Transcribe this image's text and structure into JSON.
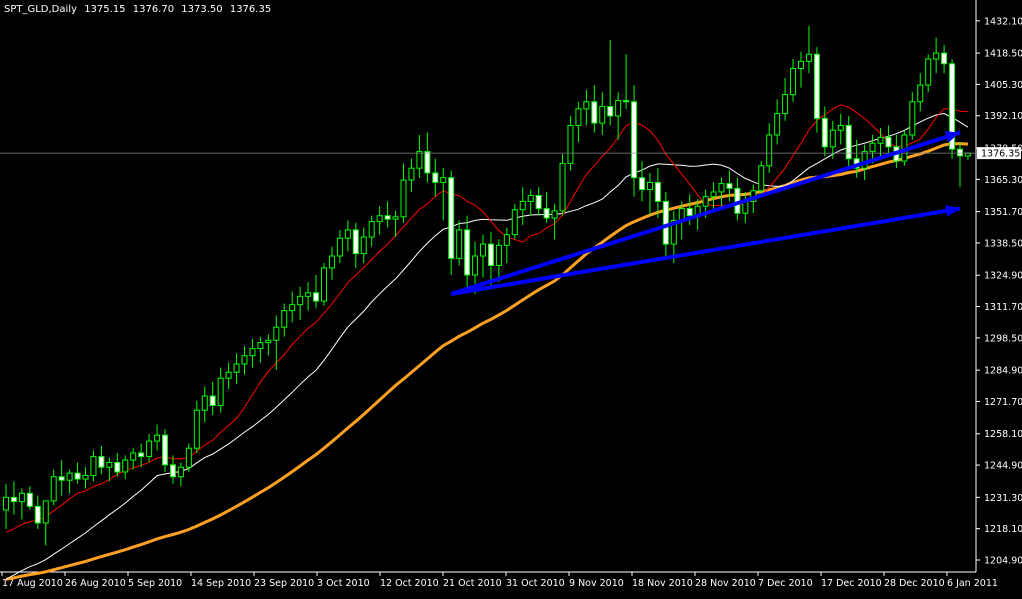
{
  "header": {
    "symbol": "SPT_GLD,Daily",
    "open": "1375.15",
    "high": "1376.70",
    "low": "1373.50",
    "close": "1376.35"
  },
  "chart_data": {
    "type": "candlestick",
    "title": "SPT_GLD,Daily",
    "ylim": [
      1204.9,
      1437.5
    ],
    "y_ticks": [
      "1432.10",
      "1418.50",
      "1405.30",
      "1392.10",
      "1378.50",
      "1365.30",
      "1351.70",
      "1338.50",
      "1324.90",
      "1311.70",
      "1298.50",
      "1284.90",
      "1271.70",
      "1258.10",
      "1244.90",
      "1231.30",
      "1218.10",
      "1204.90"
    ],
    "x_tick_labels": [
      "17 Aug 2010",
      "26 Aug 2010",
      "5 Sep 2010",
      "14 Sep 2010",
      "23 Sep 2010",
      "3 Oct 2010",
      "12 Oct 2010",
      "21 Oct 2010",
      "31 Oct 2010",
      "9 Nov 2010",
      "18 Nov 2010",
      "28 Nov 2010",
      "7 Dec 2010",
      "17 Dec 2010",
      "28 Dec 2010",
      "6 Jan 2011"
    ],
    "current_price": "1376.35",
    "colors": {
      "background": "#000000",
      "candle": "#00ff00",
      "candle_body": "#ffffff",
      "ma_fast": "#ff0000",
      "ma_mid": "#ffffff",
      "ma_slow": "#ffa020",
      "trendline": "#0000ff",
      "axis_text": "#ffffff"
    },
    "candles": [
      [
        1226.0,
        1237.0,
        1218.0,
        1231.3
      ],
      [
        1231.3,
        1238.0,
        1224.0,
        1229.5
      ],
      [
        1229.5,
        1235.0,
        1222.0,
        1233.0
      ],
      [
        1233.0,
        1236.0,
        1226.0,
        1227.5
      ],
      [
        1227.5,
        1232.0,
        1218.0,
        1220.5
      ],
      [
        1220.5,
        1230.0,
        1211.0,
        1229.8
      ],
      [
        1229.8,
        1243.0,
        1228.0,
        1240.0
      ],
      [
        1240.0,
        1247.0,
        1232.0,
        1238.5
      ],
      [
        1238.5,
        1243.0,
        1233.0,
        1241.5
      ],
      [
        1241.5,
        1246.0,
        1237.0,
        1239.0
      ],
      [
        1239.0,
        1244.0,
        1235.0,
        1240.5
      ],
      [
        1240.5,
        1251.0,
        1238.0,
        1248.5
      ],
      [
        1248.5,
        1253.0,
        1241.0,
        1244.0
      ],
      [
        1244.0,
        1248.0,
        1238.0,
        1246.0
      ],
      [
        1246.0,
        1250.0,
        1240.0,
        1242.0
      ],
      [
        1242.0,
        1249.0,
        1239.0,
        1247.0
      ],
      [
        1247.0,
        1252.0,
        1243.0,
        1250.0
      ],
      [
        1250.0,
        1254.0,
        1244.0,
        1248.5
      ],
      [
        1248.5,
        1258.0,
        1246.0,
        1255.0
      ],
      [
        1255.0,
        1262.0,
        1251.0,
        1257.5
      ],
      [
        1257.5,
        1260.0,
        1242.0,
        1245.0
      ],
      [
        1245.0,
        1249.0,
        1237.0,
        1240.0
      ],
      [
        1240.0,
        1246.0,
        1236.0,
        1244.0
      ],
      [
        1244.0,
        1254.0,
        1242.0,
        1252.0
      ],
      [
        1252.0,
        1272.0,
        1250.0,
        1268.0
      ],
      [
        1268.0,
        1278.0,
        1263.0,
        1274.0
      ],
      [
        1274.0,
        1280.0,
        1266.0,
        1270.0
      ],
      [
        1270.0,
        1286.0,
        1267.0,
        1281.5
      ],
      [
        1281.5,
        1288.0,
        1277.0,
        1284.0
      ],
      [
        1284.0,
        1292.0,
        1279.0,
        1287.5
      ],
      [
        1287.5,
        1295.0,
        1283.0,
        1291.0
      ],
      [
        1291.0,
        1298.0,
        1286.0,
        1294.0
      ],
      [
        1294.0,
        1299.0,
        1288.0,
        1296.5
      ],
      [
        1296.5,
        1300.0,
        1291.0,
        1297.5
      ],
      [
        1297.5,
        1308.0,
        1285.0,
        1303.0
      ],
      [
        1303.0,
        1313.0,
        1299.0,
        1310.0
      ],
      [
        1310.0,
        1318.0,
        1305.0,
        1312.5
      ],
      [
        1312.5,
        1320.0,
        1306.0,
        1316.0
      ],
      [
        1316.0,
        1322.0,
        1310.0,
        1317.5
      ],
      [
        1317.5,
        1325.0,
        1311.0,
        1314.0
      ],
      [
        1314.0,
        1330.0,
        1312.0,
        1328.0
      ],
      [
        1328.0,
        1337.0,
        1323.0,
        1333.0
      ],
      [
        1333.0,
        1344.0,
        1330.0,
        1340.5
      ],
      [
        1340.5,
        1348.0,
        1335.0,
        1344.0
      ],
      [
        1344.0,
        1347.0,
        1328.0,
        1334.0
      ],
      [
        1334.0,
        1345.0,
        1330.0,
        1341.0
      ],
      [
        1341.0,
        1350.0,
        1337.0,
        1347.5
      ],
      [
        1347.5,
        1354.0,
        1342.0,
        1350.0
      ],
      [
        1350.0,
        1356.0,
        1345.0,
        1348.5
      ],
      [
        1348.5,
        1352.0,
        1341.0,
        1349.5
      ],
      [
        1349.5,
        1372.0,
        1347.0,
        1365.0
      ],
      [
        1365.0,
        1374.0,
        1360.0,
        1370.0
      ],
      [
        1370.0,
        1384.0,
        1366.0,
        1377.0
      ],
      [
        1377.0,
        1385.0,
        1364.0,
        1368.0
      ],
      [
        1368.0,
        1374.0,
        1358.0,
        1364.0
      ],
      [
        1364.0,
        1370.0,
        1348.0,
        1366.0
      ],
      [
        1366.0,
        1369.0,
        1325.0,
        1332.0
      ],
      [
        1332.0,
        1348.0,
        1329.0,
        1344.0
      ],
      [
        1344.0,
        1350.0,
        1320.0,
        1325.0
      ],
      [
        1325.0,
        1339.0,
        1317.0,
        1333.0
      ],
      [
        1333.0,
        1342.0,
        1324.0,
        1338.0
      ],
      [
        1338.0,
        1343.0,
        1319.0,
        1329.0
      ],
      [
        1329.0,
        1340.0,
        1322.0,
        1337.5
      ],
      [
        1337.5,
        1345.0,
        1330.0,
        1342.0
      ],
      [
        1342.0,
        1355.0,
        1340.0,
        1352.5
      ],
      [
        1352.5,
        1362.0,
        1346.0,
        1356.0
      ],
      [
        1356.0,
        1361.0,
        1350.0,
        1358.5
      ],
      [
        1358.5,
        1362.0,
        1350.0,
        1353.0
      ],
      [
        1353.0,
        1360.0,
        1347.0,
        1349.0
      ],
      [
        1349.0,
        1355.0,
        1340.0,
        1352.0
      ],
      [
        1352.0,
        1376.0,
        1350.0,
        1372.0
      ],
      [
        1372.0,
        1392.0,
        1369.0,
        1388.0
      ],
      [
        1388.0,
        1398.0,
        1381.0,
        1395.0
      ],
      [
        1395.0,
        1403.0,
        1388.0,
        1398.0
      ],
      [
        1398.0,
        1405.0,
        1385.0,
        1389.0
      ],
      [
        1389.0,
        1402.0,
        1384.0,
        1396.0
      ],
      [
        1396.0,
        1424.0,
        1388.0,
        1392.0
      ],
      [
        1392.0,
        1402.0,
        1382.0,
        1398.5
      ],
      [
        1398.5,
        1418.0,
        1395.0,
        1398.0
      ],
      [
        1398.0,
        1405.0,
        1358.0,
        1366.0
      ],
      [
        1366.0,
        1373.0,
        1356.0,
        1361.0
      ],
      [
        1361.0,
        1368.0,
        1350.0,
        1364.0
      ],
      [
        1364.0,
        1370.0,
        1349.0,
        1356.0
      ],
      [
        1356.0,
        1360.0,
        1332.0,
        1338.0
      ],
      [
        1338.0,
        1352.0,
        1330.0,
        1348.0
      ],
      [
        1348.0,
        1356.0,
        1340.0,
        1353.0
      ],
      [
        1353.0,
        1359.0,
        1346.0,
        1350.0
      ],
      [
        1350.0,
        1357.0,
        1344.0,
        1354.0
      ],
      [
        1354.0,
        1361.0,
        1349.0,
        1358.0
      ],
      [
        1358.0,
        1364.0,
        1352.0,
        1360.0
      ],
      [
        1360.0,
        1366.0,
        1354.0,
        1363.5
      ],
      [
        1363.5,
        1369.0,
        1356.0,
        1361.5
      ],
      [
        1361.5,
        1366.0,
        1348.0,
        1351.0
      ],
      [
        1351.0,
        1360.0,
        1347.0,
        1356.0
      ],
      [
        1356.0,
        1363.0,
        1351.0,
        1360.5
      ],
      [
        1360.5,
        1373.0,
        1358.0,
        1371.0
      ],
      [
        1371.0,
        1389.0,
        1368.0,
        1384.0
      ],
      [
        1384.0,
        1399.0,
        1380.0,
        1393.0
      ],
      [
        1393.0,
        1408.0,
        1390.0,
        1401.0
      ],
      [
        1401.0,
        1416.0,
        1398.0,
        1412.0
      ],
      [
        1412.0,
        1419.0,
        1404.0,
        1415.0
      ],
      [
        1415.0,
        1430.0,
        1410.0,
        1418.0
      ],
      [
        1418.0,
        1421.0,
        1385.0,
        1391.0
      ],
      [
        1391.0,
        1396.0,
        1375.0,
        1379.0
      ],
      [
        1379.0,
        1390.0,
        1374.0,
        1386.0
      ],
      [
        1386.0,
        1393.0,
        1380.0,
        1388.0
      ],
      [
        1388.0,
        1392.0,
        1370.0,
        1374.0
      ],
      [
        1374.0,
        1382.0,
        1366.0,
        1370.0
      ],
      [
        1370.0,
        1380.0,
        1365.0,
        1377.0
      ],
      [
        1377.0,
        1384.0,
        1372.0,
        1380.5
      ],
      [
        1380.5,
        1387.0,
        1375.0,
        1383.0
      ],
      [
        1383.0,
        1388.0,
        1376.0,
        1379.0
      ],
      [
        1379.0,
        1384.0,
        1370.0,
        1373.0
      ],
      [
        1373.0,
        1386.0,
        1371.0,
        1384.0
      ],
      [
        1384.0,
        1402.0,
        1382.0,
        1398.0
      ],
      [
        1398.0,
        1410.0,
        1394.0,
        1405.0
      ],
      [
        1405.0,
        1418.0,
        1402.0,
        1416.0
      ],
      [
        1416.0,
        1425.0,
        1410.0,
        1418.5
      ],
      [
        1418.5,
        1422.0,
        1410.0,
        1414.0
      ],
      [
        1414.0,
        1416.0,
        1374.0,
        1378.0
      ],
      [
        1378.0,
        1381.0,
        1362.0,
        1375.2
      ],
      [
        1375.15,
        1376.7,
        1373.5,
        1376.35
      ]
    ],
    "ma_fast_label": "red moving average",
    "ma_mid_label": "white moving average",
    "ma_slow_label": "orange moving average",
    "trendlines": [
      {
        "start": [
          56,
          1317.0
        ],
        "end": [
          120,
          1385.0
        ],
        "arrow": true
      },
      {
        "start": [
          56,
          1317.0
        ],
        "end": [
          120,
          1353.0
        ],
        "arrow": true
      }
    ]
  }
}
